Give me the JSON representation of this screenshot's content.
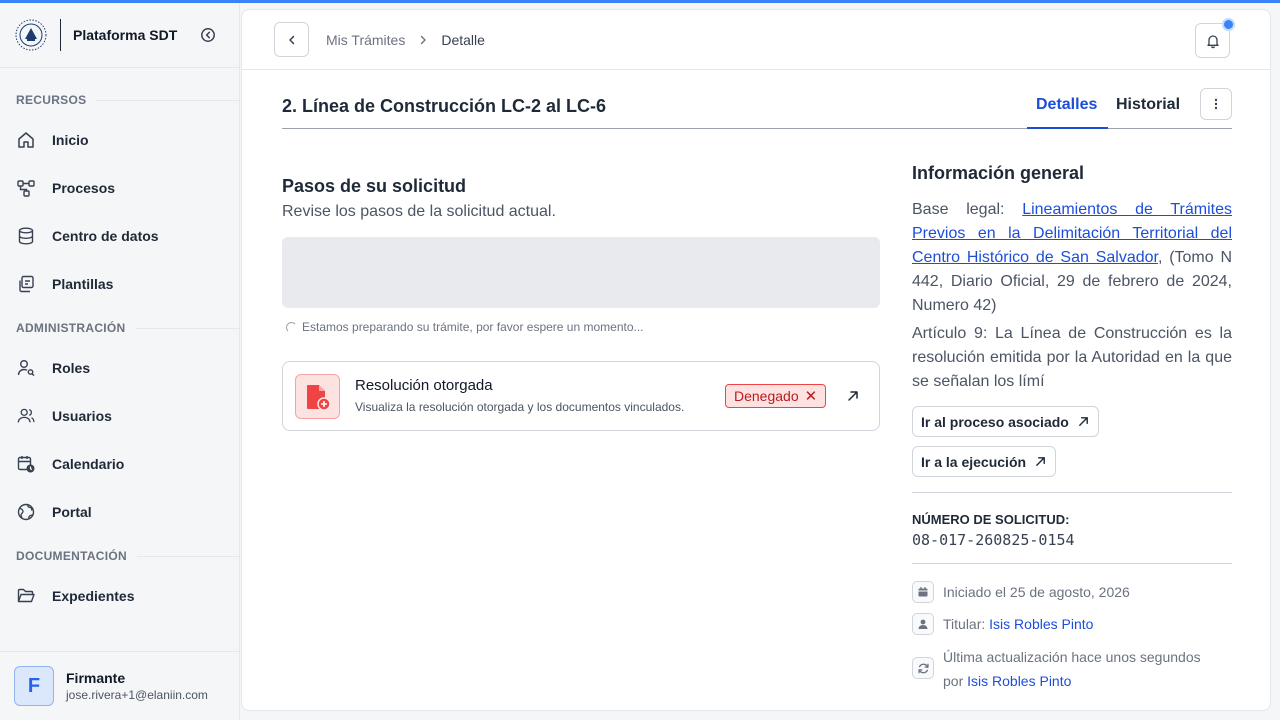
{
  "app": {
    "name": "Plataforma SDT"
  },
  "sidebar": {
    "sections": [
      {
        "label": "RECURSOS",
        "items": [
          {
            "label": "Inicio",
            "icon": "home-icon"
          },
          {
            "label": "Procesos",
            "icon": "workflow-icon"
          },
          {
            "label": "Centro de datos",
            "icon": "database-icon"
          },
          {
            "label": "Plantillas",
            "icon": "templates-icon"
          }
        ]
      },
      {
        "label": "ADMINISTRACIÓN",
        "items": [
          {
            "label": "Roles",
            "icon": "user-key-icon"
          },
          {
            "label": "Usuarios",
            "icon": "users-icon"
          },
          {
            "label": "Calendario",
            "icon": "calendar-clock-icon"
          },
          {
            "label": "Portal",
            "icon": "globe-icon"
          }
        ]
      },
      {
        "label": "DOCUMENTACIÓN",
        "items": [
          {
            "label": "Expedientes",
            "icon": "folder-open-icon"
          }
        ]
      }
    ],
    "user": {
      "initial": "F",
      "name": "Firmante",
      "email": "jose.rivera+1@elaniin.com"
    }
  },
  "header": {
    "breadcrumb": [
      "Mis Trámites",
      "Detalle"
    ]
  },
  "page": {
    "title": "2. Línea de Construcción LC-2 al LC-6",
    "tabs": [
      "Detalles",
      "Historial"
    ],
    "active_tab": "Detalles"
  },
  "steps": {
    "title": "Pasos de su solicitud",
    "subtitle": "Revise los pasos de la solicitud actual.",
    "loading_text": "Estamos preparando su trámite, por favor espere un momento..."
  },
  "resolution": {
    "title": "Resolución otorgada",
    "subtitle": "Visualiza la resolución otorgada y los documentos vinculados.",
    "status": "Denegado",
    "status_color": "#b91c1c"
  },
  "info": {
    "title": "Información general",
    "legal_prefix": "Base legal: ",
    "legal_link": "Lineamientos de Trámites Previos en la Delimitación Territorial del Centro Histórico de San Salvador",
    "legal_suffix": ", (Tomo N 442, Diario Oficial, 29 de febrero de 2024, Numero 42)",
    "article": "Artículo 9: La Línea de Construcción es la resolución emitida por la Autoridad en la que se señalan los límí",
    "btn_process": "Ir al proceso asociado",
    "btn_execution": "Ir a la ejecución",
    "request_label": "NÚMERO DE SOLICITUD:",
    "request_number": "08-017-260825-0154",
    "started": "Iniciado el 25 de agosto, 2026",
    "holder_label": "Titular: ",
    "holder_name": "Isis Robles Pinto",
    "updated": "Última actualización hace unos segundos",
    "updated_by_prefix": "por ",
    "updated_by": "Isis Robles Pinto"
  },
  "colors": {
    "accent": "#1d4ed8",
    "notification": "#3b82f6"
  }
}
